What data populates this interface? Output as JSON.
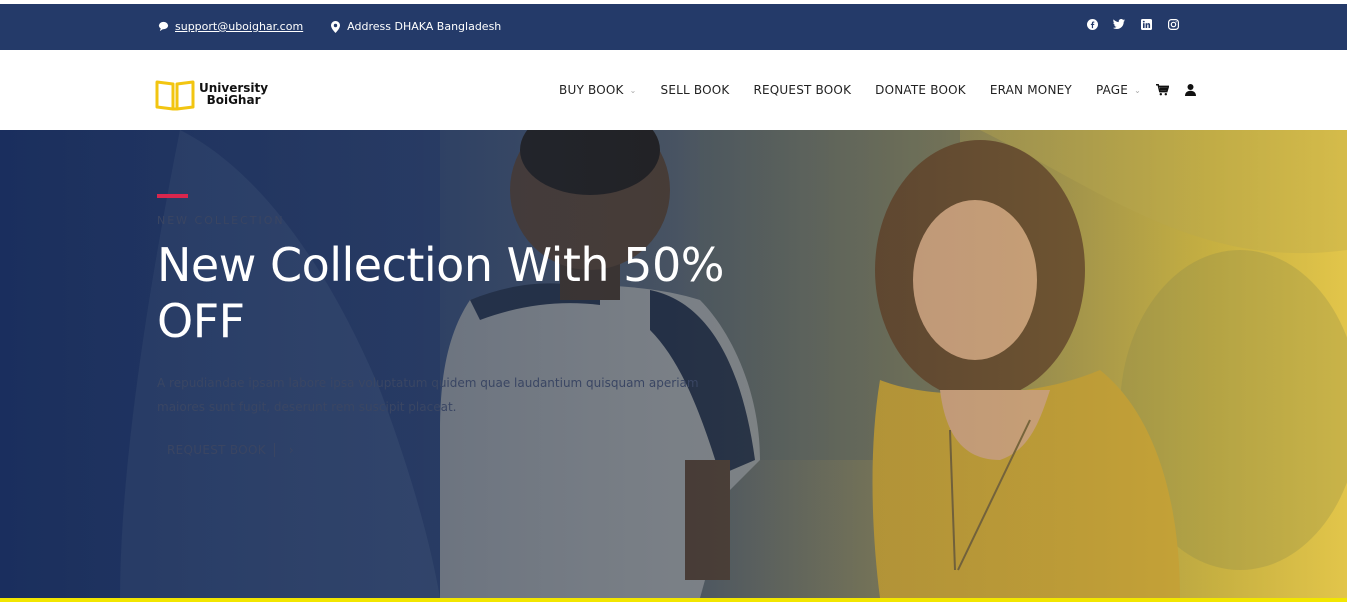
{
  "topbar": {
    "email": "support@uboighar.com",
    "address": "Address DHAKA Bangladesh",
    "social": [
      "facebook-icon",
      "twitter-icon",
      "linkedin-icon",
      "instagram-icon"
    ]
  },
  "logo": {
    "line1": "University",
    "line2": "BoiGhar",
    "color": "#f2c511"
  },
  "nav": {
    "items": [
      {
        "label": "BUY BOOK",
        "dropdown": true
      },
      {
        "label": "SELL BOOK",
        "dropdown": false
      },
      {
        "label": "REQUEST BOOK",
        "dropdown": false
      },
      {
        "label": "DONATE BOOK",
        "dropdown": false
      },
      {
        "label": "ERAN MONEY",
        "dropdown": false
      },
      {
        "label": "PAGE",
        "dropdown": true
      }
    ],
    "icons": [
      "cart-icon",
      "user-icon"
    ]
  },
  "hero": {
    "kicker": "NEW COLLECTION",
    "title": "New Collection With 50% OFF",
    "description": "A repudiandae ipsam labore ipsa voluptatum quidem quae laudantium quisquam aperiam maiores sunt fugit, deserunt rem suscipit placeat.",
    "cta_label": "REQUEST BOOK"
  },
  "colors": {
    "topbar": "#243a69",
    "accent": "#d9264d",
    "strip": "#f2e600"
  }
}
